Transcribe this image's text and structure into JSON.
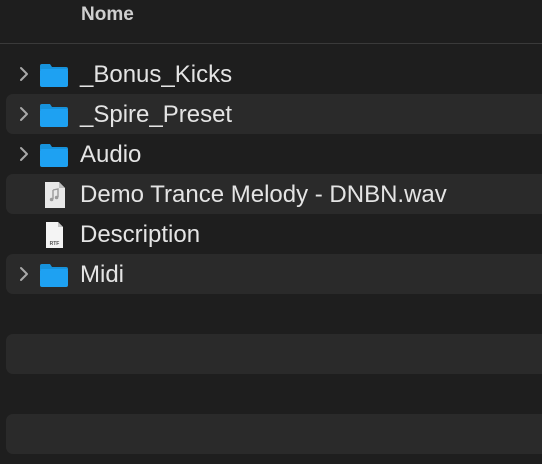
{
  "header": {
    "column_name": "Nome"
  },
  "files": [
    {
      "name": "_Bonus_Kicks",
      "kind": "folder",
      "expandable": true
    },
    {
      "name": "_Spire_Preset",
      "kind": "folder",
      "expandable": true
    },
    {
      "name": "Audio",
      "kind": "folder",
      "expandable": true
    },
    {
      "name": "Demo Trance Melody - DNBN.wav",
      "kind": "audio",
      "expandable": false
    },
    {
      "name": "Description",
      "kind": "rtf",
      "expandable": false,
      "badge": "RTF"
    },
    {
      "name": "Midi",
      "kind": "folder",
      "expandable": true
    }
  ],
  "colors": {
    "background": "#1e1e1e",
    "alternate_row": "#2a2a2a",
    "folder_blue": "#1ea1f2",
    "text": "#e4e4e4"
  }
}
